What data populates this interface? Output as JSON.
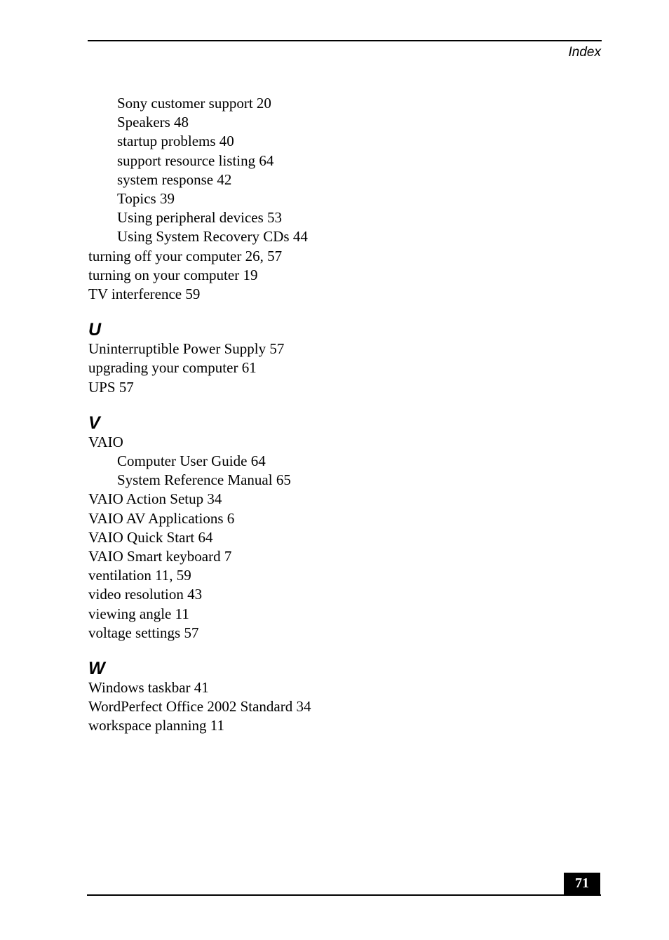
{
  "header": {
    "running_head": "Index"
  },
  "footer": {
    "page_number": "71"
  },
  "index": {
    "t_continued": [
      {
        "text": "Sony customer support 20",
        "level": 2
      },
      {
        "text": "Speakers 48",
        "level": 2
      },
      {
        "text": "startup problems 40",
        "level": 2
      },
      {
        "text": "support resource listing 64",
        "level": 2
      },
      {
        "text": "system response 42",
        "level": 2
      },
      {
        "text": "Topics 39",
        "level": 2
      },
      {
        "text": "Using peripheral devices 53",
        "level": 2
      },
      {
        "text": "Using System Recovery CDs 44",
        "level": 2
      },
      {
        "text": "turning off your computer 26, 57",
        "level": 1
      },
      {
        "text": "turning on your computer 19",
        "level": 1
      },
      {
        "text": "TV interference 59",
        "level": 1
      }
    ],
    "u": {
      "letter": "U",
      "entries": [
        {
          "text": "Uninterruptible Power Supply 57",
          "level": 1
        },
        {
          "text": "upgrading your computer 61",
          "level": 1
        },
        {
          "text": "UPS 57",
          "level": 1
        }
      ]
    },
    "v": {
      "letter": "V",
      "entries": [
        {
          "text": "VAIO",
          "level": 1
        },
        {
          "text": "Computer User Guide 64",
          "level": 2
        },
        {
          "text": "System Reference Manual 65",
          "level": 2
        },
        {
          "text": "VAIO Action Setup 34",
          "level": 1
        },
        {
          "text": "VAIO AV Applications 6",
          "level": 1
        },
        {
          "text": "VAIO Quick Start 64",
          "level": 1
        },
        {
          "text": "VAIO Smart keyboard 7",
          "level": 1
        },
        {
          "text": "ventilation 11, 59",
          "level": 1
        },
        {
          "text": "video resolution 43",
          "level": 1
        },
        {
          "text": "viewing angle 11",
          "level": 1
        },
        {
          "text": "voltage settings 57",
          "level": 1
        }
      ]
    },
    "w": {
      "letter": "W",
      "entries": [
        {
          "text": "Windows taskbar 41",
          "level": 1
        },
        {
          "text": "WordPerfect Office 2002 Standard 34",
          "level": 1
        },
        {
          "text": "workspace planning 11",
          "level": 1
        }
      ]
    }
  }
}
